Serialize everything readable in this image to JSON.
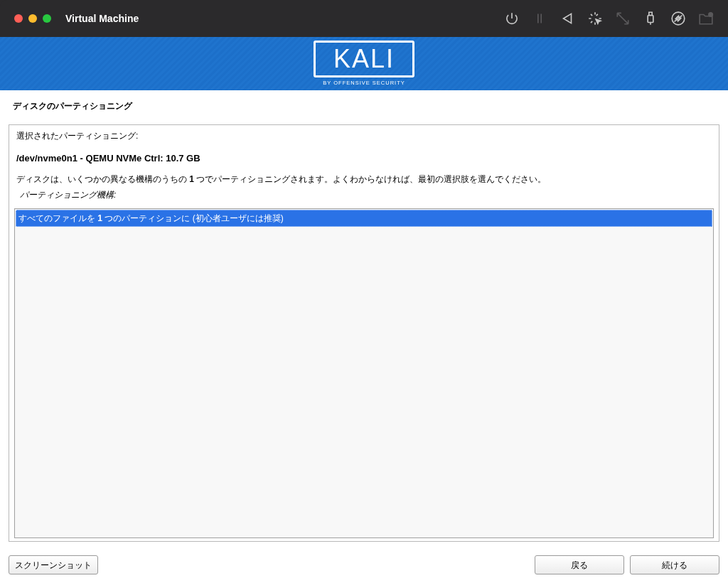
{
  "window": {
    "title": "Virtual Machine"
  },
  "toolbar": [
    {
      "kind": "power",
      "disabled": false
    },
    {
      "kind": "pause",
      "disabled": true
    },
    {
      "kind": "back",
      "disabled": false
    },
    {
      "kind": "capture",
      "disabled": false
    },
    {
      "kind": "resize",
      "disabled": true
    },
    {
      "kind": "usb",
      "disabled": false
    },
    {
      "kind": "disc",
      "disabled": false
    },
    {
      "kind": "folder",
      "disabled": true
    }
  ],
  "banner": {
    "logo": "KALI",
    "tagline": "BY OFFENSIVE SECURITY"
  },
  "page_title": "ディスクのパーティショニング",
  "panel": {
    "label": "選択されたパーティショニング:",
    "device": "/dev/nvme0n1 - QEMU NVMe Ctrl: 10.7 GB",
    "description": "ディスクは、いくつかの異なる機構のうちの **1** つでパーティショニングされます。よくわからなければ、最初の選択肢を選んでください。",
    "list_label": "パーティショニング機構:",
    "options": [
      {
        "label": "すべてのファイルを **1** つのパーティションに (初心者ユーザには推奨)",
        "selected": true
      }
    ]
  },
  "buttons": {
    "left": "スクリーンショット",
    "right": [
      "戻る",
      "続ける"
    ]
  }
}
